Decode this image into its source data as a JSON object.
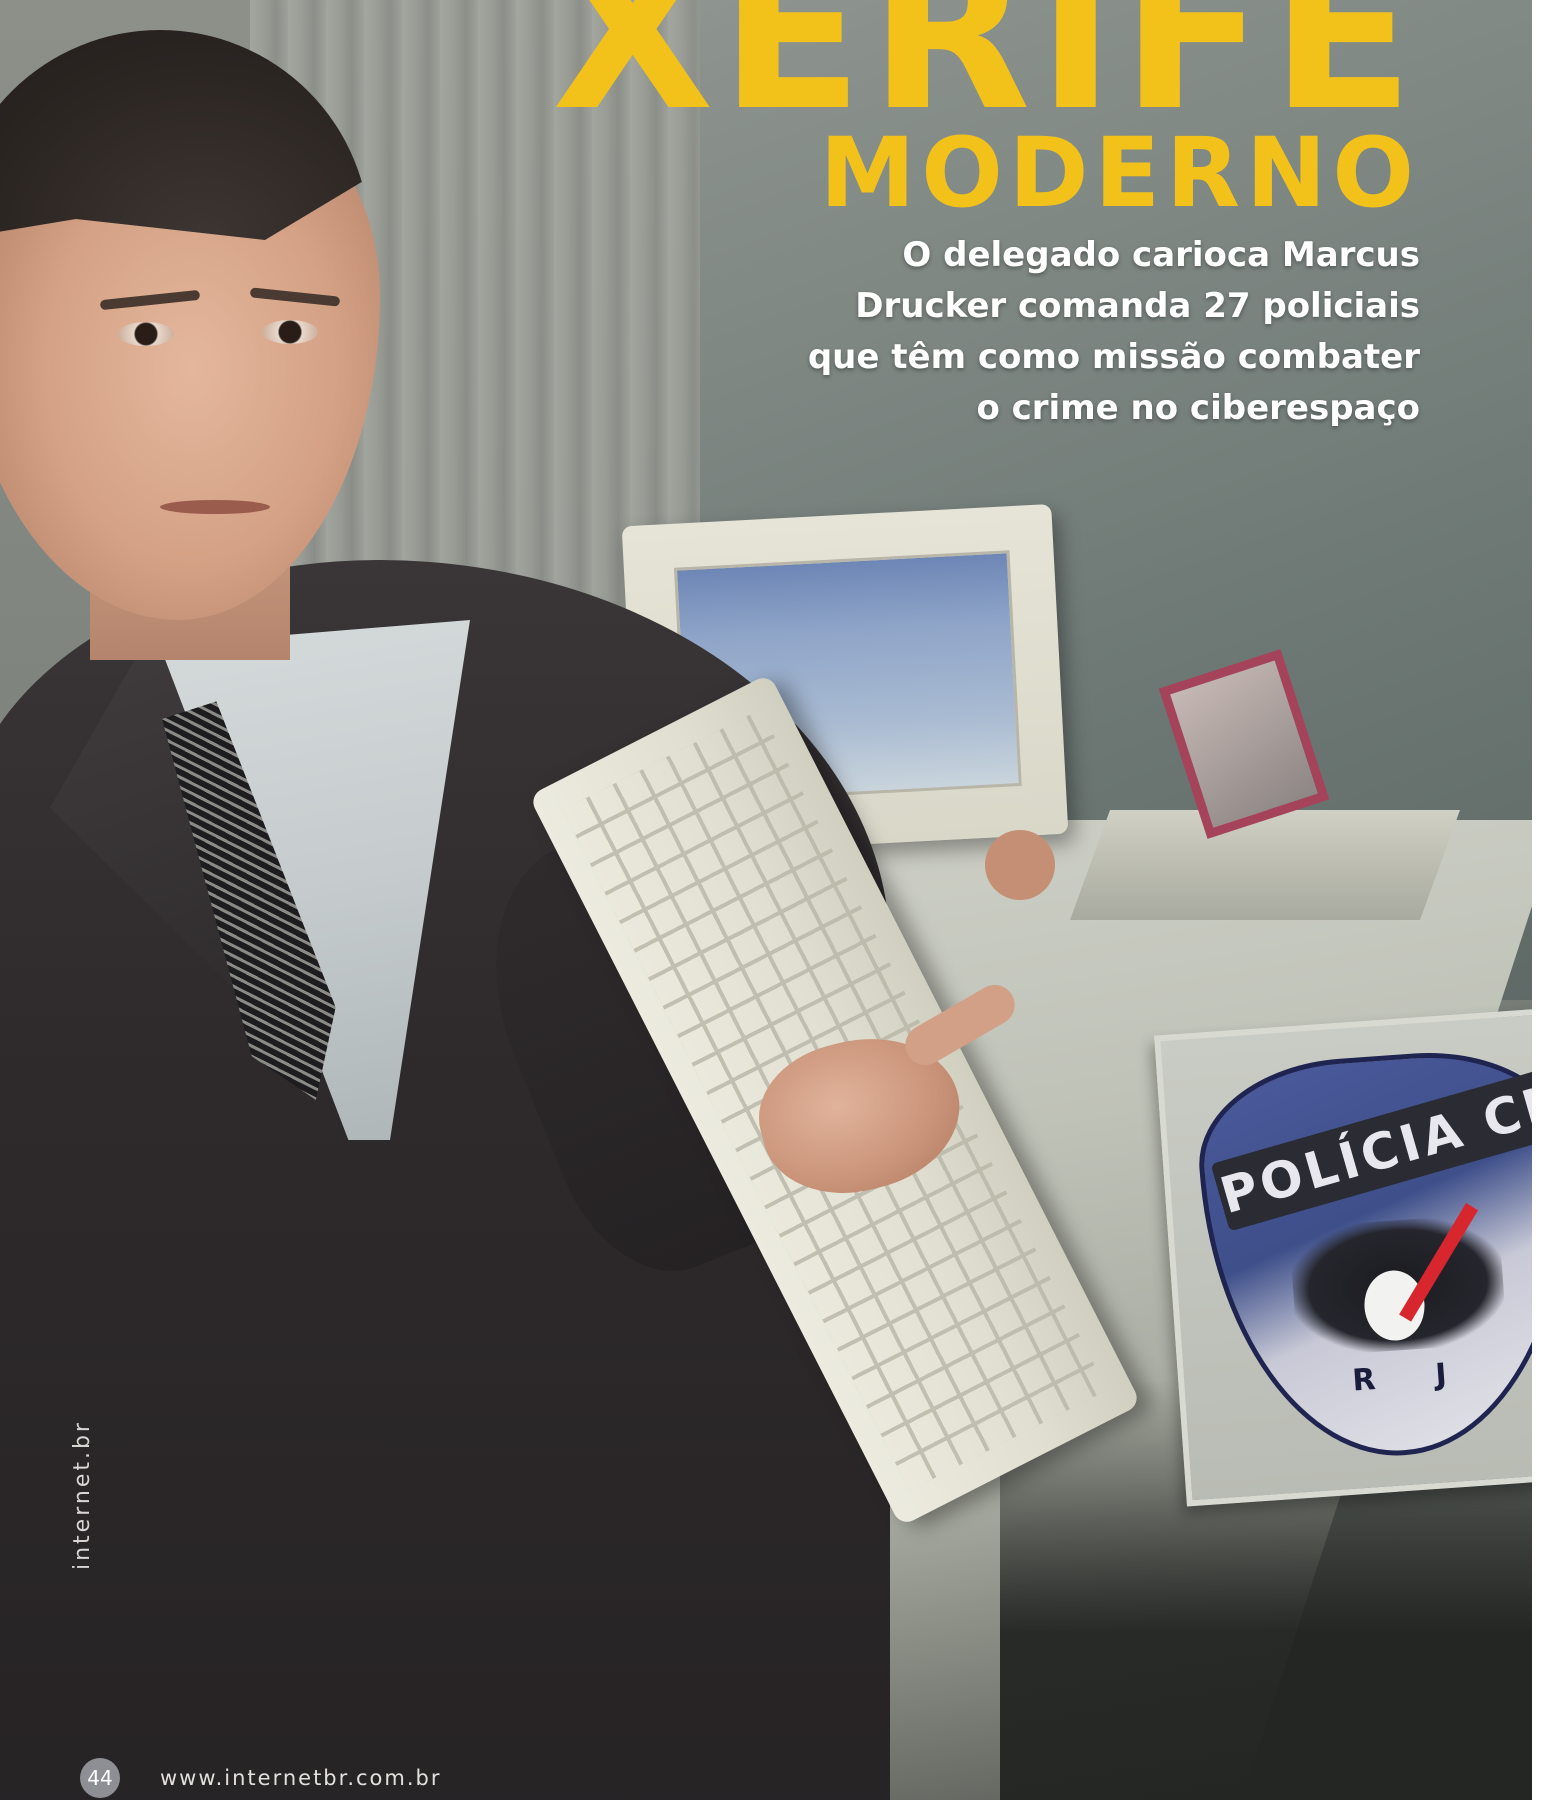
{
  "article": {
    "kicker": "XERIFE",
    "headline": "MODERNO",
    "deck_lines": [
      "O delegado carioca Marcus",
      "Drucker comanda 27 policiais",
      "que têm como missão combater",
      "o crime no ciberespaço"
    ]
  },
  "photo": {
    "sign_text": "POLÍCIA CI",
    "badge_letters": "RJ"
  },
  "footer": {
    "brand": "internet.br",
    "page_number": "44",
    "url": "www.internetbr.com.br"
  },
  "colors": {
    "headline": "#f2c21b",
    "deck": "#ffffff"
  }
}
